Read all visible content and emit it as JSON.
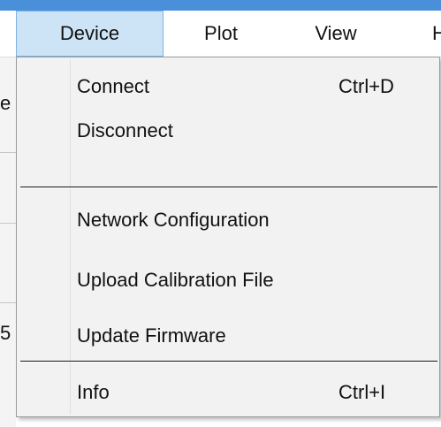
{
  "menubar": {
    "items": [
      {
        "label": "Device",
        "active": true
      },
      {
        "label": "Plot"
      },
      {
        "label": "View"
      },
      {
        "label": "H"
      }
    ]
  },
  "background": {
    "fragments": [
      "e",
      "5"
    ]
  },
  "dropdown": {
    "items": [
      {
        "label": "Connect",
        "shortcut": "Ctrl+D"
      },
      {
        "label": "Disconnect"
      },
      {
        "label": "Network Configuration"
      },
      {
        "label": "Upload Calibration File"
      },
      {
        "label": "Update Firmware"
      },
      {
        "label": "Info",
        "shortcut": "Ctrl+I"
      }
    ]
  },
  "colors": {
    "accent_strip": "#4a8fd9",
    "active_menu_bg": "#cde4f7",
    "active_menu_border": "#7fb2e5",
    "dropdown_bg": "#f2f2f2"
  }
}
